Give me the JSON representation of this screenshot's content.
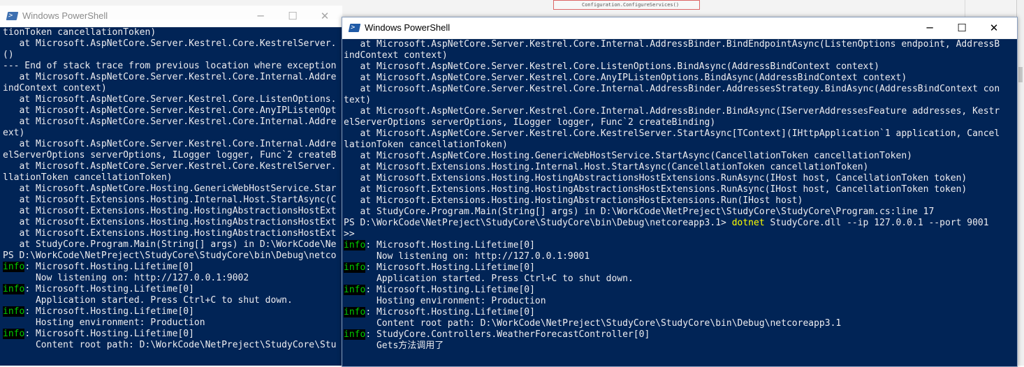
{
  "background": {
    "code_snippet": "Configuration.ConfigureServices()"
  },
  "back_window": {
    "title": "Windows PowerShell",
    "icon": "powershell-icon",
    "lines": [
      [
        {
          "t": "tionToken cancellationToken)"
        }
      ],
      [
        {
          "t": "   at Microsoft.AspNetCore.Server.Kestrel.Core.KestrelServer."
        }
      ],
      [
        {
          "t": "()"
        }
      ],
      [
        {
          "t": "--- End of stack trace from previous location where exception"
        }
      ],
      [
        {
          "t": "   at Microsoft.AspNetCore.Server.Kestrel.Core.Internal.Addre"
        }
      ],
      [
        {
          "t": "indContext context)"
        }
      ],
      [
        {
          "t": "   at Microsoft.AspNetCore.Server.Kestrel.Core.ListenOptions."
        }
      ],
      [
        {
          "t": "   at Microsoft.AspNetCore.Server.Kestrel.Core.AnyIPListenOpt"
        }
      ],
      [
        {
          "t": "   at Microsoft.AspNetCore.Server.Kestrel.Core.Internal.Addre"
        }
      ],
      [
        {
          "t": "ext)"
        }
      ],
      [
        {
          "t": "   at Microsoft.AspNetCore.Server.Kestrel.Core.Internal.Addre"
        }
      ],
      [
        {
          "t": "elServerOptions serverOptions, ILogger logger, Func`2 createB"
        }
      ],
      [
        {
          "t": "   at Microsoft.AspNetCore.Server.Kestrel.Core.KestrelServer."
        }
      ],
      [
        {
          "t": "llationToken cancellationToken)"
        }
      ],
      [
        {
          "t": "   at Microsoft.AspNetCore.Hosting.GenericWebHostService.Star"
        }
      ],
      [
        {
          "t": "   at Microsoft.Extensions.Hosting.Internal.Host.StartAsync(C"
        }
      ],
      [
        {
          "t": "   at Microsoft.Extensions.Hosting.HostingAbstractionsHostExt"
        }
      ],
      [
        {
          "t": "   at Microsoft.Extensions.Hosting.HostingAbstractionsHostExt"
        }
      ],
      [
        {
          "t": "   at Microsoft.Extensions.Hosting.HostingAbstractionsHostExt"
        }
      ],
      [
        {
          "t": "   at StudyCore.Program.Main(String[] args) in D:\\WorkCode\\Ne"
        }
      ],
      [
        {
          "t": "PS D:\\WorkCode\\NetPreject\\StudyCore\\StudyCore\\bin\\Debug\\netco"
        }
      ],
      [
        {
          "t": "info",
          "k": "lvl"
        },
        {
          "t": ": Microsoft.Hosting.Lifetime[0]"
        }
      ],
      [
        {
          "t": "      Now listening on: http://127.0.0.1:9002"
        }
      ],
      [
        {
          "t": "info",
          "k": "lvl"
        },
        {
          "t": ": Microsoft.Hosting.Lifetime[0]"
        }
      ],
      [
        {
          "t": "      Application started. Press Ctrl+C to shut down."
        }
      ],
      [
        {
          "t": "info",
          "k": "lvl"
        },
        {
          "t": ": Microsoft.Hosting.Lifetime[0]"
        }
      ],
      [
        {
          "t": "      Hosting environment: Production"
        }
      ],
      [
        {
          "t": "info",
          "k": "lvl"
        },
        {
          "t": ": Microsoft.Hosting.Lifetime[0]"
        }
      ],
      [
        {
          "t": "      Content root path: D:\\WorkCode\\NetPreject\\StudyCore\\Stu"
        }
      ]
    ]
  },
  "front_window": {
    "title": "Windows PowerShell",
    "icon": "powershell-icon",
    "controls": {
      "minimize": "minimize-icon",
      "maximize": "maximize-icon",
      "close": "close-icon"
    },
    "lines": [
      [
        {
          "t": "   at Microsoft.AspNetCore.Server.Kestrel.Core.Internal.AddressBinder.BindEndpointAsync(ListenOptions endpoint, AddressB"
        }
      ],
      [
        {
          "t": "indContext context)"
        }
      ],
      [
        {
          "t": "   at Microsoft.AspNetCore.Server.Kestrel.Core.ListenOptions.BindAsync(AddressBindContext context)"
        }
      ],
      [
        {
          "t": "   at Microsoft.AspNetCore.Server.Kestrel.Core.AnyIPListenOptions.BindAsync(AddressBindContext context)"
        }
      ],
      [
        {
          "t": "   at Microsoft.AspNetCore.Server.Kestrel.Core.Internal.AddressBinder.AddressesStrategy.BindAsync(AddressBindContext con"
        }
      ],
      [
        {
          "t": "text)"
        }
      ],
      [
        {
          "t": "   at Microsoft.AspNetCore.Server.Kestrel.Core.Internal.AddressBinder.BindAsync(IServerAddressesFeature addresses, Kestr"
        }
      ],
      [
        {
          "t": "elServerOptions serverOptions, ILogger logger, Func`2 createBinding)"
        }
      ],
      [
        {
          "t": "   at Microsoft.AspNetCore.Server.Kestrel.Core.KestrelServer.StartAsync[TContext](IHttpApplication`1 application, Cancel"
        }
      ],
      [
        {
          "t": "lationToken cancellationToken)"
        }
      ],
      [
        {
          "t": "   at Microsoft.AspNetCore.Hosting.GenericWebHostService.StartAsync(CancellationToken cancellationToken)"
        }
      ],
      [
        {
          "t": "   at Microsoft.Extensions.Hosting.Internal.Host.StartAsync(CancellationToken cancellationToken)"
        }
      ],
      [
        {
          "t": "   at Microsoft.Extensions.Hosting.HostingAbstractionsHostExtensions.RunAsync(IHost host, CancellationToken token)"
        }
      ],
      [
        {
          "t": "   at Microsoft.Extensions.Hosting.HostingAbstractionsHostExtensions.RunAsync(IHost host, CancellationToken token)"
        }
      ],
      [
        {
          "t": "   at Microsoft.Extensions.Hosting.HostingAbstractionsHostExtensions.Run(IHost host)"
        }
      ],
      [
        {
          "t": "   at StudyCore.Program.Main(String[] args) in D:\\WorkCode\\NetPreject\\StudyCore\\StudyCore\\Program.cs:line 17"
        }
      ],
      [
        {
          "t": "PS D:\\WorkCode\\NetPreject\\StudyCore\\StudyCore\\bin\\Debug\\netcoreapp3.1> "
        },
        {
          "t": "dotnet",
          "k": "cmd"
        },
        {
          "t": " StudyCore.dll --ip 127.0.0.1 --port 9001"
        }
      ],
      [
        {
          "t": ">>"
        }
      ],
      [
        {
          "t": "info",
          "k": "lvl"
        },
        {
          "t": ": Microsoft.Hosting.Lifetime[0]"
        }
      ],
      [
        {
          "t": "      Now listening on: http://127.0.0.1:9001"
        }
      ],
      [
        {
          "t": "info",
          "k": "lvl"
        },
        {
          "t": ": Microsoft.Hosting.Lifetime[0]"
        }
      ],
      [
        {
          "t": "      Application started. Press Ctrl+C to shut down."
        }
      ],
      [
        {
          "t": "info",
          "k": "lvl"
        },
        {
          "t": ": Microsoft.Hosting.Lifetime[0]"
        }
      ],
      [
        {
          "t": "      Hosting environment: Production"
        }
      ],
      [
        {
          "t": "info",
          "k": "lvl"
        },
        {
          "t": ": Microsoft.Hosting.Lifetime[0]"
        }
      ],
      [
        {
          "t": "      Content root path: D:\\WorkCode\\NetPreject\\StudyCore\\StudyCore\\bin\\Debug\\netcoreapp3.1"
        }
      ],
      [
        {
          "t": "info",
          "k": "lvl"
        },
        {
          "t": ": StudyCore.Controllers.WeatherForecastController[0]"
        }
      ],
      [
        {
          "t": "      Gets方法调用了"
        }
      ],
      [
        {
          "t": ""
        }
      ],
      [
        {
          "t": "",
          "k": "cursor"
        }
      ]
    ]
  },
  "colors": {
    "console_bg": "#012456",
    "console_fg": "#eeedf0",
    "info_fg": "#00cc00",
    "command_fg": "#ffff00"
  }
}
